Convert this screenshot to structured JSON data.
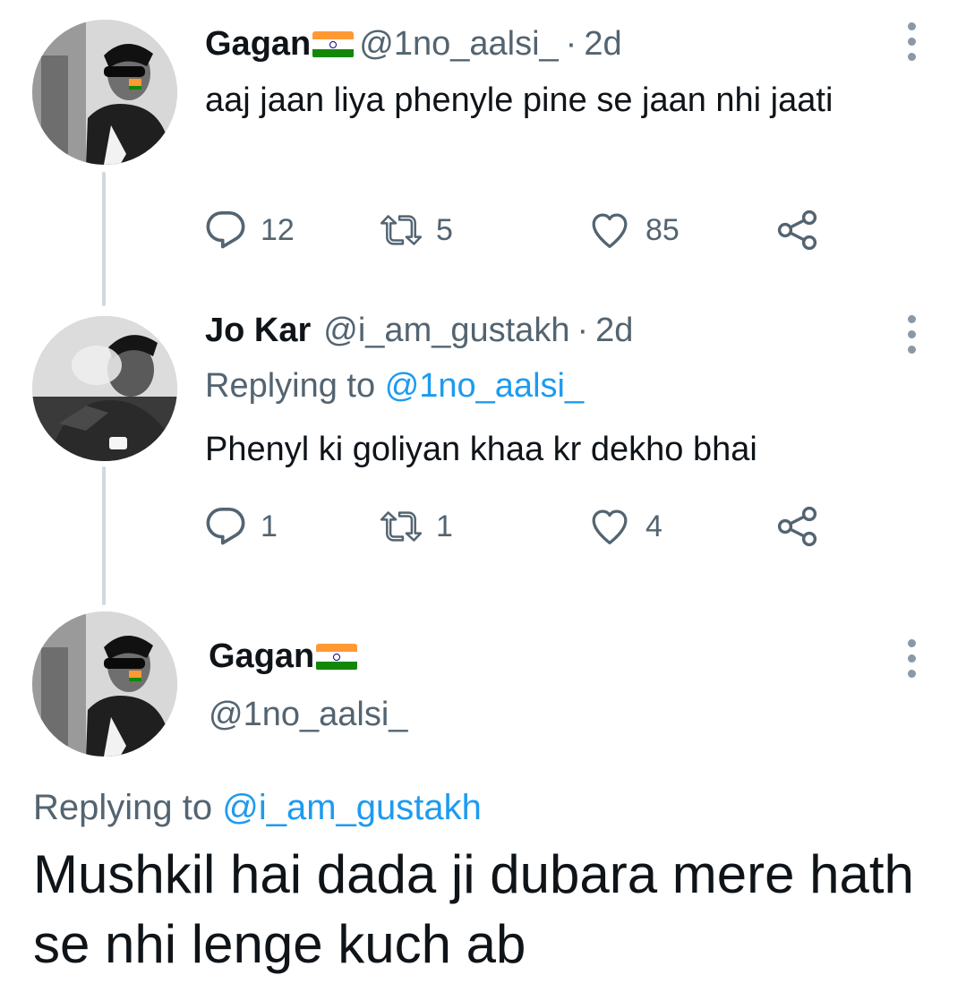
{
  "colors": {
    "text": "#0f1419",
    "muted": "#536471",
    "link": "#1d9bf0",
    "thread_line": "#cfd9de",
    "flag_saffron": "#ff9933",
    "flag_green": "#138808"
  },
  "tweets": [
    {
      "name": "Gagan",
      "name_emoji": "india-flag",
      "handle": "@1no_aalsi_",
      "separator": "·",
      "time": "2d",
      "text": "aaj jaan liya phenyle pine se jaan nhi jaati",
      "replies": "12",
      "retweets": "5",
      "likes": "85"
    },
    {
      "name": "Jo Kar",
      "handle": "@i_am_gustakh",
      "separator": "·",
      "time": "2d",
      "replying_label": "Replying to",
      "replying_to": "@1no_aalsi_",
      "text": "Phenyl ki goliyan khaa kr dekho bhai",
      "replies": "1",
      "retweets": "1",
      "likes": "4"
    }
  ],
  "focused_tweet": {
    "name": "Gagan",
    "name_emoji": "india-flag",
    "handle": "@1no_aalsi_",
    "replying_label": "Replying to",
    "replying_to": "@i_am_gustakh",
    "text": "Mushkil hai dada ji dubara mere hath se nhi lenge kuch ab"
  },
  "icons": {
    "reply": "reply-icon",
    "retweet": "retweet-icon",
    "like": "heart-icon",
    "share": "share-icon",
    "more": "more-vertical-icon"
  }
}
